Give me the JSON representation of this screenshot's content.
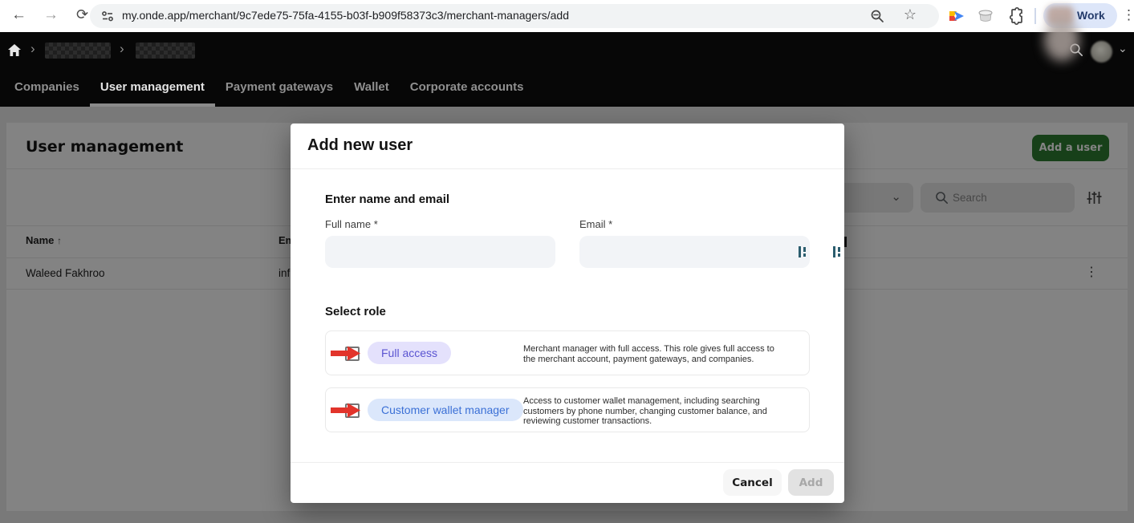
{
  "browser": {
    "url": "my.onde.app/merchant/9c7ede75-75fa-4155-b03f-b909f58373c3/merchant-managers/add",
    "profile_label": "Work",
    "icons": {
      "back": "←",
      "forward": "→",
      "refresh": "⟳",
      "star": "☆",
      "menu": "⋮"
    }
  },
  "app_header": {
    "icons": {
      "crumb_chevron": "›",
      "avatar_caret": "⌄"
    },
    "tabs": [
      {
        "label": "Companies",
        "active": false
      },
      {
        "label": "User management",
        "active": true
      },
      {
        "label": "Payment gateways",
        "active": false
      },
      {
        "label": "Wallet",
        "active": false
      },
      {
        "label": "Corporate accounts",
        "active": false
      }
    ]
  },
  "page": {
    "title": "User management",
    "add_user_button": "Add a user",
    "search_placeholder": "Search",
    "dropdown_caret": "⌄",
    "table": {
      "name_header": "Name",
      "sort_icon": "↑",
      "email_header_truncated": "Em",
      "row_menu_icon": "⋮",
      "rows": [
        {
          "name": "Waleed Fakhroo",
          "email_truncated": "inf"
        }
      ]
    }
  },
  "modal": {
    "title": "Add new user",
    "name_email_section": "Enter name and email",
    "full_name_label": "Full name *",
    "email_label": "Email *",
    "role_section": "Select role",
    "roles": [
      {
        "chip": "Full access",
        "chip_bg": "#e4e1fc",
        "chip_color": "#5a54d1",
        "checked": false,
        "description": "Merchant manager with full access. This role gives full access to the merchant account, payment gateways, and companies."
      },
      {
        "chip": "Customer wallet manager",
        "chip_bg": "#dbe7fb",
        "chip_color": "#3b70d6",
        "checked": false,
        "description": "Access to customer wallet management, including searching customers by phone number, changing customer balance, and reviewing customer transactions."
      }
    ],
    "cancel_button": "Cancel",
    "add_button": "Add"
  },
  "colors": {
    "accent_green": "#2e7d32",
    "annotation_arrow": "#e2342b",
    "header_bg": "#070707",
    "input_bg": "#f2f4f7",
    "autofill_icon_teal": "#2b5d6e"
  }
}
